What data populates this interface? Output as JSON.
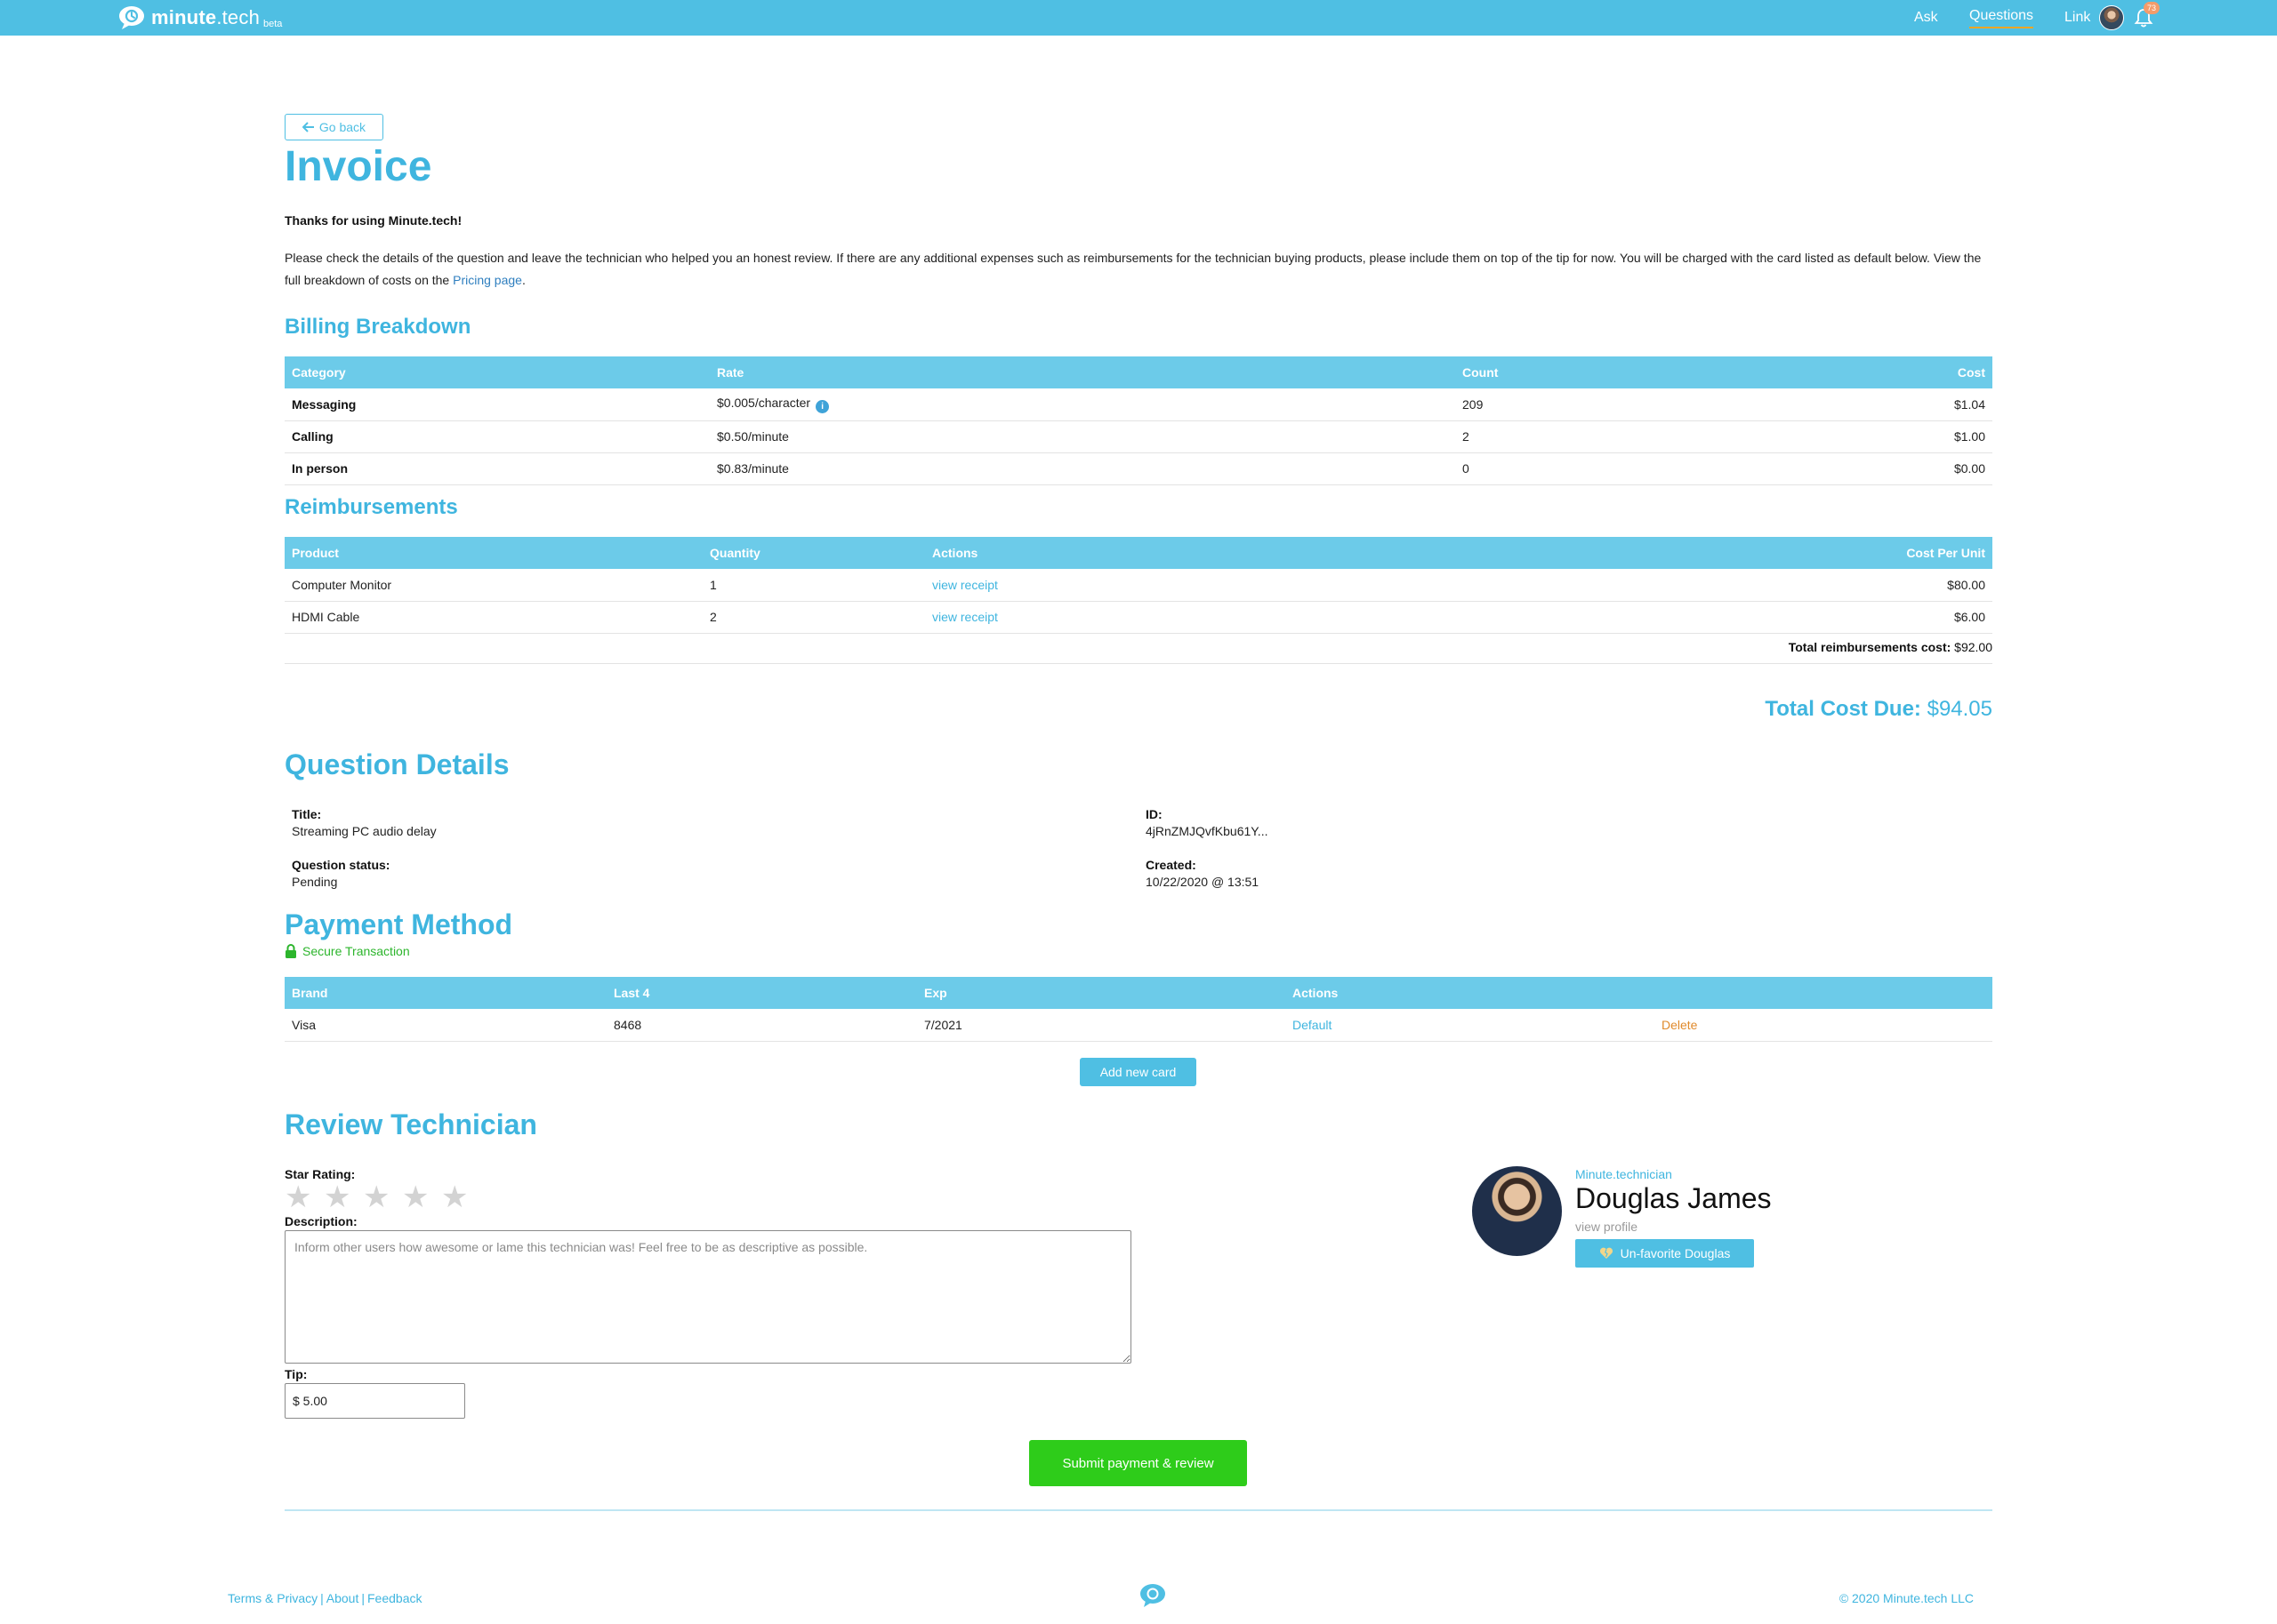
{
  "app": {
    "logo_text": "minute",
    "logo_suffix": ".tech",
    "logo_beta": "beta",
    "colors": {
      "brand": "#4fbfe3",
      "heading": "#3fb5df",
      "success": "#2ecc1a",
      "warn": "#e08a2b"
    }
  },
  "nav": {
    "ask": "Ask",
    "questions": "Questions",
    "link": "Link",
    "notification_count": "73"
  },
  "page": {
    "go_back": "Go back",
    "title": "Invoice",
    "thanks": "Thanks for using Minute.tech!",
    "intro_before_link": "Please check the details of the question and leave the technician who helped you an honest review. If there are any additional expenses such as reimbursements for the technician buying products, please include them on top of the tip for now. You will be charged with the card listed as default below. View the full breakdown of costs on the ",
    "intro_link": "Pricing page",
    "intro_after_link": "."
  },
  "billing": {
    "heading": "Billing Breakdown",
    "columns": [
      "Category",
      "Rate",
      "Count",
      "Cost"
    ],
    "rows": [
      {
        "category": "Messaging",
        "rate": "$0.005/character",
        "count": "209",
        "cost": "$1.04"
      },
      {
        "category": "Calling",
        "rate": "$0.50/minute",
        "count": "2",
        "cost": "$1.00"
      },
      {
        "category": "In person",
        "rate": "$0.83/minute",
        "count": "0",
        "cost": "$0.00"
      }
    ]
  },
  "reimbursements": {
    "heading": "Reimbursements",
    "columns": [
      "Product",
      "Quantity",
      "Actions",
      "Cost Per Unit"
    ],
    "rows": [
      {
        "product": "Computer Monitor",
        "quantity": "1",
        "action": "view receipt",
        "cost": "$80.00"
      },
      {
        "product": "HDMI Cable",
        "quantity": "2",
        "action": "view receipt",
        "cost": "$6.00"
      }
    ],
    "total_label": "Total reimbursements cost:",
    "total_value": "$92.00"
  },
  "total_due": {
    "label": "Total Cost Due:",
    "value": "$94.05"
  },
  "question_details": {
    "heading": "Question Details",
    "title_label": "Title:",
    "title_value": "Streaming PC audio delay",
    "id_label": "ID:",
    "id_value": "4jRnZMJQvfKbu61Y...",
    "status_label": "Question status:",
    "status_value": "Pending",
    "created_label": "Created:",
    "created_value": "10/22/2020 @ 13:51"
  },
  "payment": {
    "heading": "Payment Method",
    "secure": "Secure Transaction",
    "columns": [
      "Brand",
      "Last 4",
      "Exp",
      "Actions"
    ],
    "rows": [
      {
        "brand": "Visa",
        "last4": "8468",
        "exp": "7/2021",
        "default": "Default",
        "delete": "Delete"
      }
    ],
    "add_card": "Add new card"
  },
  "review": {
    "heading": "Review Technician",
    "star_label": "Star Rating:",
    "rating": 0,
    "max_rating": 5,
    "desc_label": "Description:",
    "desc_placeholder": "Inform other users how awesome or lame this technician was! Feel free to be as descriptive as possible.",
    "tip_label": "Tip:",
    "tip_value": "$ 5.00",
    "submit": "Submit payment & review"
  },
  "technician": {
    "role": "Minute.technician",
    "name": "Douglas James",
    "view_profile": "view profile",
    "unfavorite": "Un-favorite Douglas"
  },
  "footer": {
    "terms": "Terms & Privacy",
    "about": "About",
    "feedback": "Feedback",
    "separator": "|",
    "copyright": "© 2020 Minute.tech LLC"
  }
}
